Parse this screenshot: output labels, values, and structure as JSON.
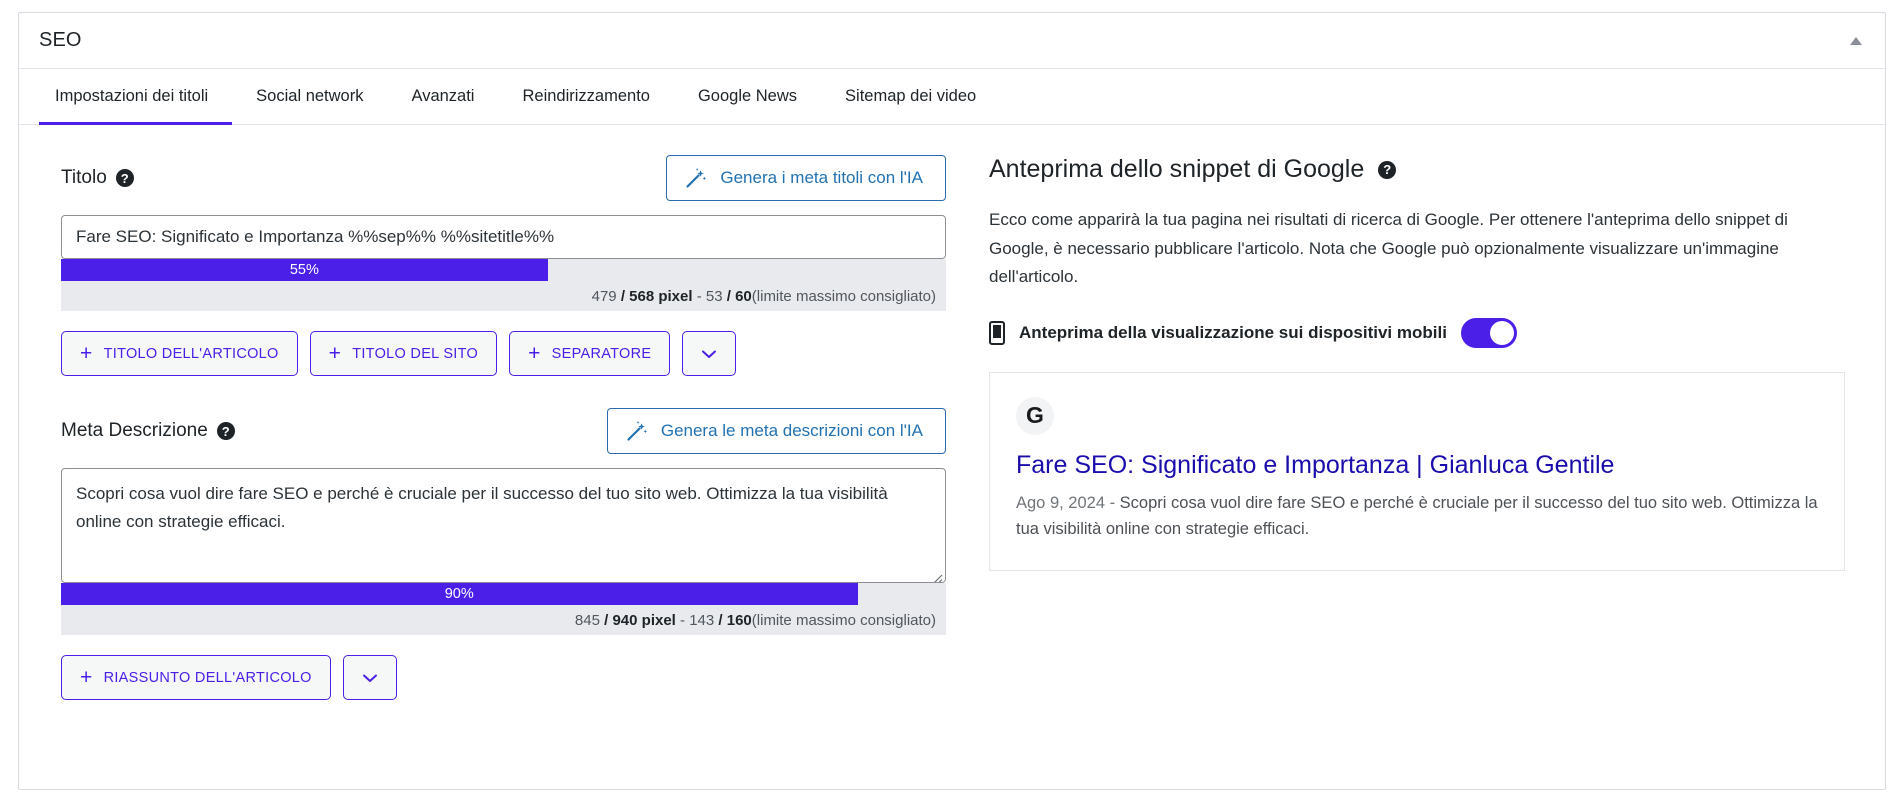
{
  "header": {
    "title": "SEO",
    "collapse_icon": "caret-up-icon"
  },
  "tabs": [
    {
      "label": "Impostazioni dei titoli",
      "active": true
    },
    {
      "label": "Social network",
      "active": false
    },
    {
      "label": "Avanzati",
      "active": false
    },
    {
      "label": "Reindirizzamento",
      "active": false
    },
    {
      "label": "Google News",
      "active": false
    },
    {
      "label": "Sitemap dei video",
      "active": false
    }
  ],
  "title_field": {
    "label": "Titolo",
    "help_icon": "help-icon",
    "ai_button": {
      "label": "Genera i meta titoli con l'IA",
      "icon": "magic-wand-icon"
    },
    "value": "Fare SEO: Significato e Importanza %%sep%% %%sitetitle%%",
    "placeholder": "",
    "meter": {
      "percent_label": "55%",
      "percent": 55,
      "pixels_current": "479",
      "pixels_sep": "/",
      "pixels_max": "568 pixel",
      "dash": "-",
      "chars_current": "53",
      "chars_sep": "/",
      "chars_max": "60",
      "limit_note": "(limite massimo consigliato)"
    },
    "tags": [
      {
        "label": "TITOLO DELL'ARTICOLO",
        "icon": "plus-icon"
      },
      {
        "label": "TITOLO DEL SITO",
        "icon": "plus-icon"
      },
      {
        "label": "SEPARATORE",
        "icon": "plus-icon"
      }
    ],
    "more_icon": "chevron-down-icon"
  },
  "description_field": {
    "label": "Meta Descrizione",
    "help_icon": "help-icon",
    "ai_button": {
      "label": "Genera le meta descrizioni con l'IA",
      "icon": "magic-wand-icon"
    },
    "value": "Scopri cosa vuol dire fare SEO e perché è cruciale per il successo del tuo sito web. Ottimizza la tua visibilità online con strategie efficaci.",
    "placeholder": "",
    "resize_icon": "resize-grip-icon",
    "meter": {
      "percent_label": "90%",
      "percent": 90,
      "pixels_current": "845",
      "pixels_sep": "/",
      "pixels_max": "940 pixel",
      "dash": "-",
      "chars_current": "143",
      "chars_sep": "/",
      "chars_max": "160",
      "limit_note": "(limite massimo consigliato)"
    },
    "tags": [
      {
        "label": "RIASSUNTO DELL'ARTICOLO",
        "icon": "plus-icon"
      }
    ],
    "more_icon": "chevron-down-icon"
  },
  "preview": {
    "title": "Anteprima dello snippet di Google",
    "help_icon": "help-icon",
    "description": "Ecco come apparirà la tua pagina nei risultati di ricerca di Google. Per ottenere l'anteprima dello snippet di Google, è necessario pubblicare l'articolo. Nota che Google può opzionalmente visualizzare un'immagine dell'articolo.",
    "mobile_toggle": {
      "label": "Anteprima della visualizzazione sui dispositivi mobili",
      "icon": "mobile-phone-icon",
      "enabled": true
    },
    "snippet": {
      "favicon_letter": "G",
      "headline": "Fare SEO: Significato e Importanza | Gianluca Gentile",
      "date": "Ago 9, 2024 - ",
      "body": "Scopri cosa vuol dire fare SEO e perché è cruciale per il successo del tuo sito web. Ottimizza la tua visibilità online con strategie efficaci."
    }
  },
  "colors": {
    "accent_purple": "#4b1fe8",
    "link_blue": "#1a0dab",
    "ai_blue": "#2271b1",
    "meter_track": "#e9eaed"
  }
}
